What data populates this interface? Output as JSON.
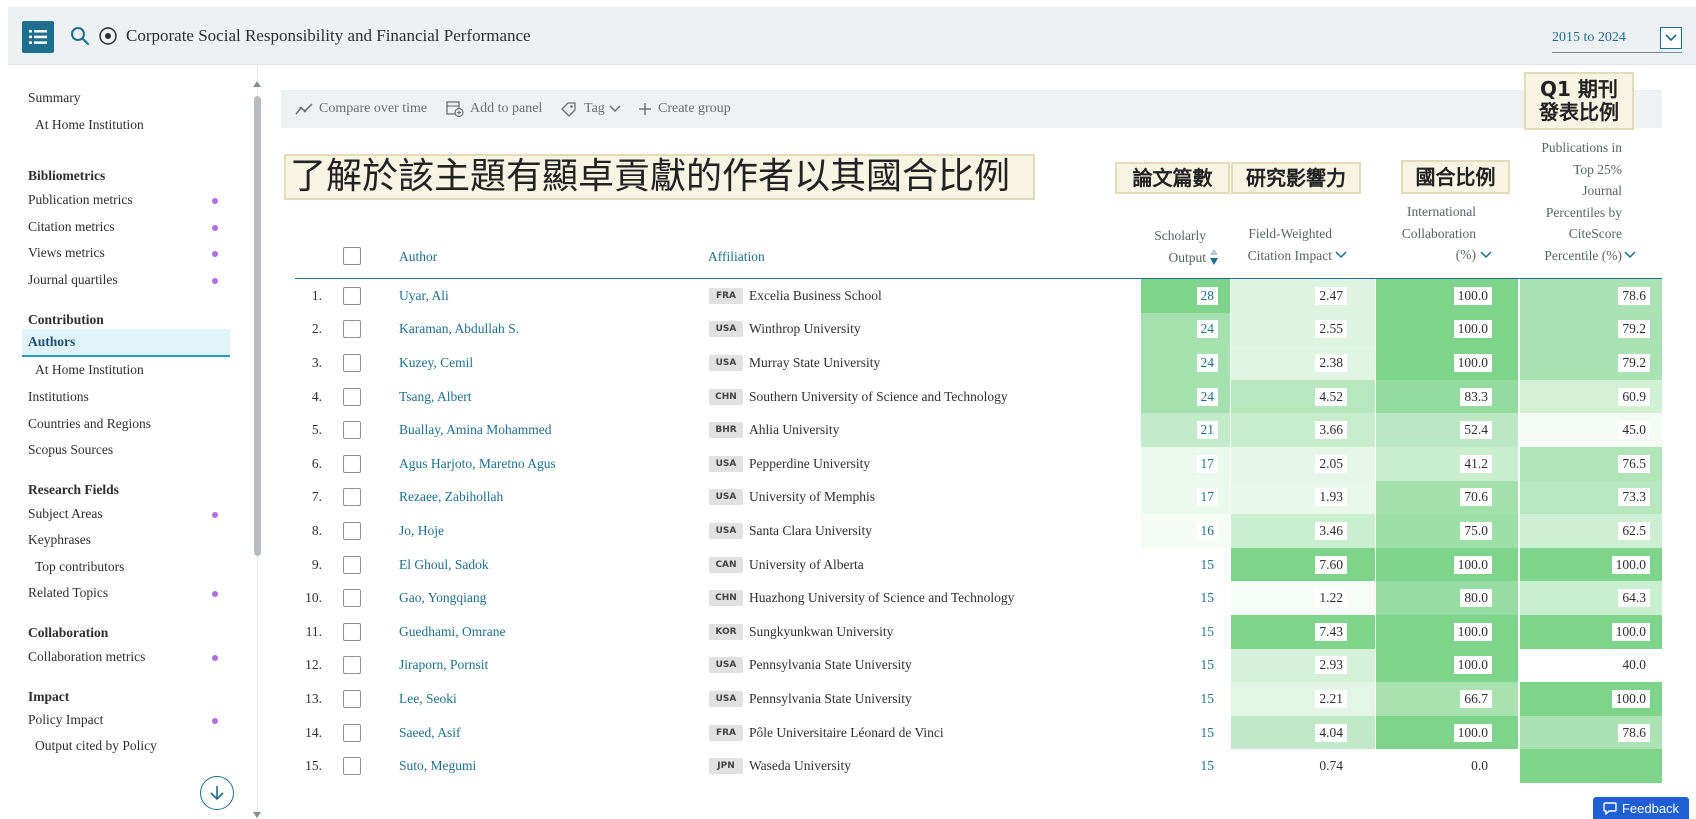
{
  "header": {
    "topic_title": "Corporate Social Responsibility and Financial Performance",
    "year_range": "2015 to 2024"
  },
  "sidebar": {
    "sections": [
      {
        "type": "item",
        "label": "Summary",
        "dot": false
      },
      {
        "type": "sub",
        "label": "At Home Institution",
        "dot": false
      },
      {
        "type": "head",
        "label": "Bibliometrics"
      },
      {
        "type": "item",
        "label": "Publication metrics",
        "dot": true
      },
      {
        "type": "item",
        "label": "Citation metrics",
        "dot": true
      },
      {
        "type": "item",
        "label": "Views metrics",
        "dot": true
      },
      {
        "type": "item",
        "label": "Journal quartiles",
        "dot": true
      },
      {
        "type": "head",
        "label": "Contribution"
      },
      {
        "type": "active",
        "label": "Authors",
        "dot": false
      },
      {
        "type": "sub",
        "label": "At Home Institution",
        "dot": false
      },
      {
        "type": "item",
        "label": "Institutions",
        "dot": false
      },
      {
        "type": "item",
        "label": "Countries and Regions",
        "dot": false
      },
      {
        "type": "item",
        "label": "Scopus Sources",
        "dot": false
      },
      {
        "type": "head",
        "label": "Research Fields"
      },
      {
        "type": "item",
        "label": "Subject Areas",
        "dot": true
      },
      {
        "type": "item",
        "label": "Keyphrases",
        "dot": false
      },
      {
        "type": "sub",
        "label": "Top contributors",
        "dot": false
      },
      {
        "type": "item",
        "label": "Related Topics",
        "dot": true
      },
      {
        "type": "head",
        "label": "Collaboration"
      },
      {
        "type": "item",
        "label": "Collaboration metrics",
        "dot": true
      },
      {
        "type": "head",
        "label": "Impact"
      },
      {
        "type": "item",
        "label": "Policy Impact",
        "dot": true
      },
      {
        "type": "sub",
        "label": "Output cited by Policy",
        "dot": false
      }
    ]
  },
  "toolbar": {
    "compare": "Compare over time",
    "add_panel": "Add to panel",
    "tag": "Tag",
    "create_group": "Create group"
  },
  "annotations": {
    "main": "了解於該主題有顯卓貢獻的作者以其國合比例",
    "publications": "論文篇數",
    "impact": "研究影響力",
    "international": "國合比例",
    "q1_line1": "Q1 期刊",
    "q1_line2": "發表比例"
  },
  "columns": {
    "author": "Author",
    "affiliation": "Affiliation",
    "output": [
      "Scholarly",
      "Output"
    ],
    "fwci": [
      "Field-Weighted",
      "Citation Impact"
    ],
    "intl": [
      "International",
      "Collaboration",
      "(%)"
    ],
    "top25": [
      "Publications in",
      "Top 25%",
      "Journal",
      "Percentiles by",
      "CiteScore",
      "Percentile (%)"
    ]
  },
  "rows": [
    {
      "rank": "1.",
      "author": "Uyar, Ali",
      "country": "FRA",
      "affiliation": "Excelia Business School",
      "output": "28",
      "fwci": "2.47",
      "intl": "100.0",
      "top25": "78.6"
    },
    {
      "rank": "2.",
      "author": "Karaman, Abdullah S.",
      "country": "USA",
      "affiliation": "Winthrop University",
      "output": "24",
      "fwci": "2.55",
      "intl": "100.0",
      "top25": "79.2"
    },
    {
      "rank": "3.",
      "author": "Kuzey, Cemil",
      "country": "USA",
      "affiliation": "Murray State University",
      "output": "24",
      "fwci": "2.38",
      "intl": "100.0",
      "top25": "79.2"
    },
    {
      "rank": "4.",
      "author": "Tsang, Albert",
      "country": "CHN",
      "affiliation": "Southern University of Science and Technology",
      "output": "24",
      "fwci": "4.52",
      "intl": "83.3",
      "top25": "60.9"
    },
    {
      "rank": "5.",
      "author": "Buallay, Amina Mohammed",
      "country": "BHR",
      "affiliation": "Ahlia University",
      "output": "21",
      "fwci": "3.66",
      "intl": "52.4",
      "top25": "45.0"
    },
    {
      "rank": "6.",
      "author": "Agus Harjoto, Maretno Agus",
      "country": "USA",
      "affiliation": "Pepperdine University",
      "output": "17",
      "fwci": "2.05",
      "intl": "41.2",
      "top25": "76.5"
    },
    {
      "rank": "7.",
      "author": "Rezaee, Zabihollah",
      "country": "USA",
      "affiliation": "University of Memphis",
      "output": "17",
      "fwci": "1.93",
      "intl": "70.6",
      "top25": "73.3"
    },
    {
      "rank": "8.",
      "author": "Jo, Hoje",
      "country": "USA",
      "affiliation": "Santa Clara University",
      "output": "16",
      "fwci": "3.46",
      "intl": "75.0",
      "top25": "62.5"
    },
    {
      "rank": "9.",
      "author": "El Ghoul, Sadok",
      "country": "CAN",
      "affiliation": "University of Alberta",
      "output": "15",
      "fwci": "7.60",
      "intl": "100.0",
      "top25": "100.0"
    },
    {
      "rank": "10.",
      "author": "Gao, Yongqiang",
      "country": "CHN",
      "affiliation": "Huazhong University of Science and Technology",
      "output": "15",
      "fwci": "1.22",
      "intl": "80.0",
      "top25": "64.3"
    },
    {
      "rank": "11.",
      "author": "Guedhami, Omrane",
      "country": "KOR",
      "affiliation": "Sungkyunkwan University",
      "output": "15",
      "fwci": "7.43",
      "intl": "100.0",
      "top25": "100.0"
    },
    {
      "rank": "12.",
      "author": "Jiraporn, Pornsit",
      "country": "USA",
      "affiliation": "Pennsylvania State University",
      "output": "15",
      "fwci": "2.93",
      "intl": "100.0",
      "top25": "40.0"
    },
    {
      "rank": "13.",
      "author": "Lee, Seoki",
      "country": "USA",
      "affiliation": "Pennsylvania State University",
      "output": "15",
      "fwci": "2.21",
      "intl": "66.7",
      "top25": "100.0"
    },
    {
      "rank": "14.",
      "author": "Saeed, Asif",
      "country": "FRA",
      "affiliation": "Pôle Universitaire Léonard de Vinci",
      "output": "15",
      "fwci": "4.04",
      "intl": "100.0",
      "top25": "78.6"
    },
    {
      "rank": "15.",
      "author": "Suto, Megumi",
      "country": "JPN",
      "affiliation": "Waseda University",
      "output": "15",
      "fwci": "0.74",
      "intl": "0.0",
      "top25": ""
    }
  ],
  "colors": {
    "brand": "#1e6f8f",
    "active_bg": "#e1f4fa",
    "dot": "#b06fe0",
    "heat_high": "#7dd48a",
    "heat_low": "#ffffff",
    "feedback": "#1f5fd6"
  },
  "icons": {
    "menu": "list-menu-icon",
    "search": "search-icon",
    "topic": "topic-target-icon",
    "compare": "trend-line-icon",
    "add_panel": "add-panel-icon",
    "tag": "tag-icon",
    "create_group": "plus-icon",
    "scroll_down": "arrow-down-circle-icon",
    "feedback": "chat-bubble-icon"
  },
  "feedback": {
    "label": "Feedback"
  }
}
